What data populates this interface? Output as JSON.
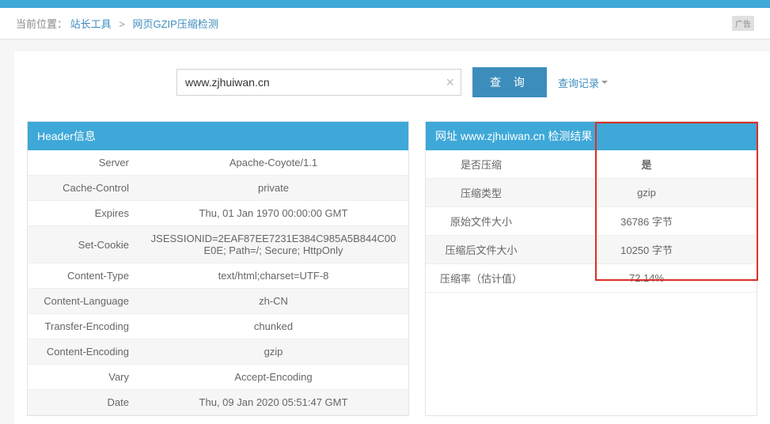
{
  "breadcrumb": {
    "prefix": "当前位置：",
    "link1": "站长工具",
    "sep": ">",
    "link2": "网页GZIP压缩检测",
    "ad": "广告"
  },
  "search": {
    "value": "www.zjhuiwan.cn",
    "query_btn": "查 询",
    "history": "查询记录"
  },
  "headerPanel": {
    "title": "Header信息",
    "rows": [
      {
        "key": "Server",
        "val": "Apache-Coyote/1.1"
      },
      {
        "key": "Cache-Control",
        "val": "private"
      },
      {
        "key": "Expires",
        "val": "Thu, 01 Jan 1970 00:00:00 GMT"
      },
      {
        "key": "Set-Cookie",
        "val": "JSESSIONID=2EAF87EE7231E384C985A5B844C00E0E; Path=/; Secure; HttpOnly"
      },
      {
        "key": "Content-Type",
        "val": "text/html;charset=UTF-8"
      },
      {
        "key": "Content-Language",
        "val": "zh-CN"
      },
      {
        "key": "Transfer-Encoding",
        "val": "chunked"
      },
      {
        "key": "Content-Encoding",
        "val": "gzip"
      },
      {
        "key": "Vary",
        "val": "Accept-Encoding"
      },
      {
        "key": "Date",
        "val": "Thu, 09 Jan 2020 05:51:47 GMT"
      }
    ]
  },
  "resultPanel": {
    "title": "网址 www.zjhuiwan.cn 检测结果",
    "rows": [
      {
        "key": "是否压缩",
        "val": "是",
        "hl": true
      },
      {
        "key": "压缩类型",
        "val": "gzip"
      },
      {
        "key": "原始文件大小",
        "val": "36786 字节"
      },
      {
        "key": "压缩后文件大小",
        "val": "10250 字节"
      },
      {
        "key": "压缩率（估计值）",
        "val": "72.14%"
      }
    ]
  }
}
